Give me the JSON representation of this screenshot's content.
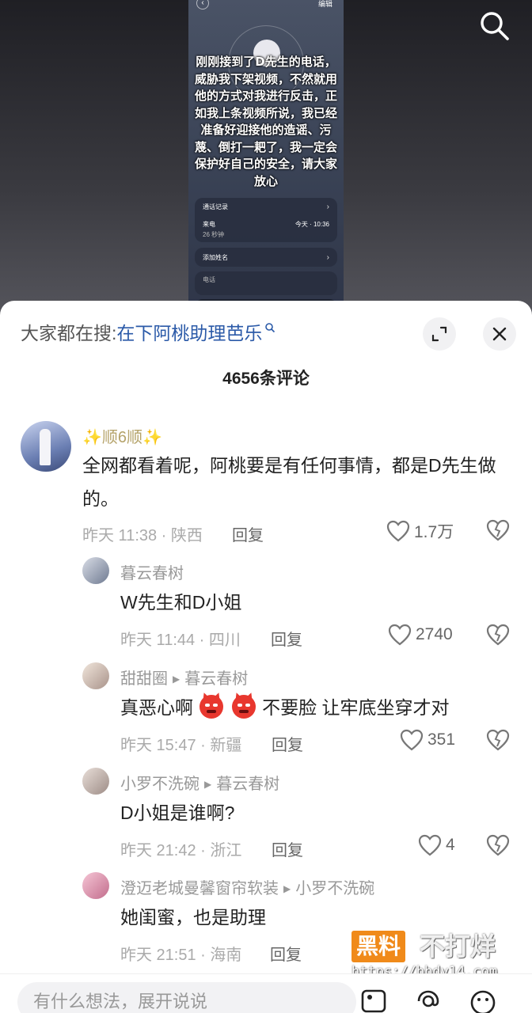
{
  "video": {
    "phone_edit_label": "编辑",
    "overlay_text": "刚刚接到了D先生的电话，威胁我下架视频，不然就用他的方式对我进行反击，正如我上条视频所说，我已经准备好迎接他的造谣、污蔑、倒打一耙了，我一定会保护好自己的安全，请大家放心",
    "call_log_label": "通话记录",
    "incoming_label": "来电",
    "incoming_time": "今天 · 10:36",
    "incoming_duration": "26 秒钟",
    "add_name_label": "添加姓名",
    "phone_label": "电话"
  },
  "sheet": {
    "search_prefix": "大家都在搜:",
    "search_term": "在下阿桃助理芭乐",
    "comment_count": "4656条评论",
    "reply_label": "回复"
  },
  "comments": [
    {
      "name": "✨顺6顺✨",
      "text": "全网都看着呢，阿桃要是有任何事情，都是D先生做的。",
      "meta": "昨天 11:38 · 陕西",
      "likes": "1.7万"
    },
    {
      "name": "暮云春树",
      "text": "W先生和D小姐",
      "meta": "昨天 11:44 · 四川",
      "likes": "2740"
    },
    {
      "name": "甜甜圈",
      "reply_to": "暮云春树",
      "text_a": "真恶心啊",
      "text_b": "不要脸 让牢底坐穿才对",
      "meta": "昨天 15:47 · 新疆",
      "likes": "351"
    },
    {
      "name": "小罗不洗碗",
      "reply_to": "暮云春树",
      "text": "D小姐是谁啊?",
      "meta": "昨天 21:42 · 浙江",
      "likes": "4"
    },
    {
      "name": "澄迈老城曼馨窗帘软装",
      "reply_to": "小罗不洗碗",
      "text": "她闺蜜，也是助理",
      "meta": "昨天 21:51 · 海南"
    }
  ],
  "input": {
    "placeholder": "有什么想法，展开说说"
  },
  "watermark": {
    "brand_box": "黑料",
    "brand_text": "不打烊",
    "url": "https://bbdy14.com"
  },
  "icons": [
    "search-icon",
    "expand-icon",
    "close-icon",
    "heart-icon",
    "broken-heart-icon",
    "image-icon",
    "at-icon",
    "emoji-icon"
  ]
}
